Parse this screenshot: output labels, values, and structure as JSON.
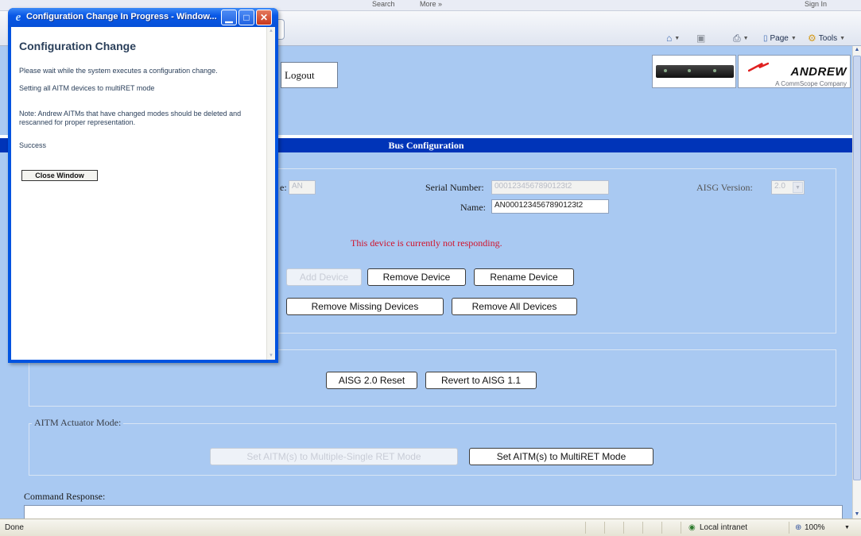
{
  "browser": {
    "top_fragments": [
      "Search",
      "More »",
      "Sign In"
    ],
    "toolbar": {
      "page_label": "Page",
      "tools_label": "Tools"
    },
    "status": {
      "left_text": "Done",
      "zone": "Local intranet",
      "zoom": "100%"
    }
  },
  "page": {
    "logout_label": "Logout",
    "brand": {
      "name": "ANDREW",
      "tagline": "A CommScope Company"
    },
    "header_title": "Bus Configuration",
    "device": {
      "type_label_fragment": "e:",
      "type_value": "AN",
      "serial_label": "Serial Number:",
      "serial_value": "0001234567890123t2",
      "name_label": "Name:",
      "name_value": "AN0001234567890123t2",
      "aisg_label": "AISG Version:",
      "aisg_value": "2.0",
      "error_message": "This device is currently not responding.",
      "add_label": "Add Device",
      "remove_label": "Remove Device",
      "rename_label": "Rename Device",
      "remove_missing_label": "Remove Missing Devices",
      "remove_all_label": "Remove All Devices"
    },
    "aisg": {
      "reset_label": "AISG 2.0 Reset",
      "revert_label": "Revert to AISG 1.1"
    },
    "aitm": {
      "legend": "AITM Actuator Mode:",
      "single_label": "Set AITM(s) to Multiple-Single RET Mode",
      "multi_label": "Set AITM(s) to MultiRET Mode"
    },
    "command_response_label": "Command Response:"
  },
  "popup": {
    "window_title": "Configuration Change In Progress - Window...",
    "heading": "Configuration Change",
    "message_line1": "Please wait while the system executes a configuration change.",
    "message_line2": "Setting all AITM devices to multiRET mode",
    "note": "Note: Andrew AITMs that have changed modes should be deleted and rescanned for proper representation.",
    "result": "Success",
    "close_button": "Close Window"
  }
}
